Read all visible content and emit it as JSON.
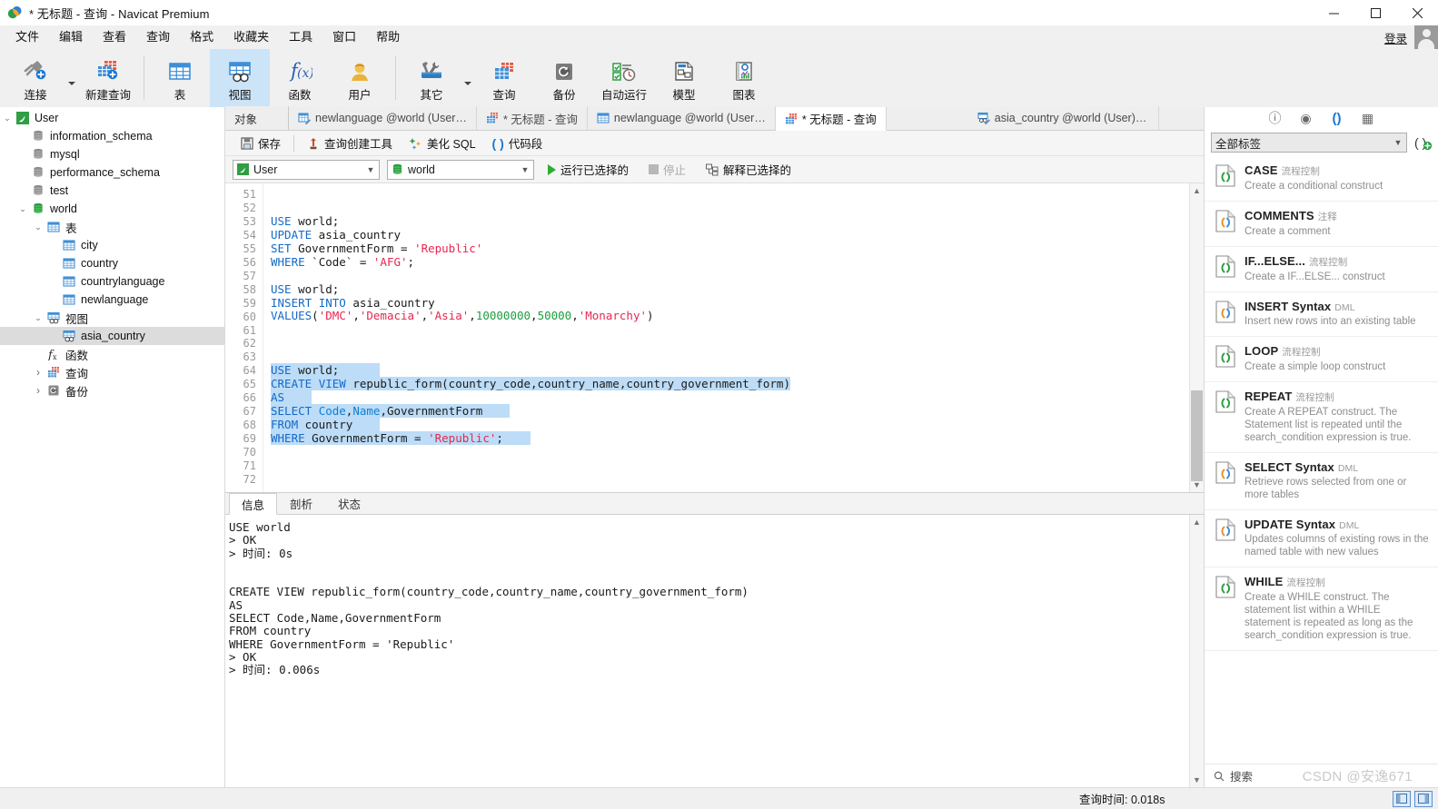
{
  "window": {
    "title": "* 无标题 - 查询 - Navicat Premium",
    "minimize": "—",
    "maximize": "▢",
    "close": "✕"
  },
  "menubar": {
    "items": [
      "文件",
      "编辑",
      "查看",
      "查询",
      "格式",
      "收藏夹",
      "工具",
      "窗口",
      "帮助"
    ],
    "login_label": "登录"
  },
  "toolbar": {
    "items": [
      {
        "label": "连接",
        "icon": "connection-icon",
        "has_caret": true
      },
      {
        "label": "新建查询",
        "icon": "new-query-icon",
        "has_caret": false
      },
      {
        "label": "表",
        "icon": "table-icon",
        "has_caret": false
      },
      {
        "label": "视图",
        "icon": "view-icon",
        "has_caret": false,
        "active": true
      },
      {
        "label": "函数",
        "icon": "function-icon",
        "has_caret": false
      },
      {
        "label": "用户",
        "icon": "user-icon",
        "has_caret": false
      },
      {
        "label": "其它",
        "icon": "other-tools-icon",
        "has_caret": true
      },
      {
        "label": "查询",
        "icon": "query-icon",
        "has_caret": false
      },
      {
        "label": "备份",
        "icon": "backup-icon",
        "has_caret": false
      },
      {
        "label": "自动运行",
        "icon": "automation-icon",
        "has_caret": false
      },
      {
        "label": "模型",
        "icon": "model-icon",
        "has_caret": false
      },
      {
        "label": "图表",
        "icon": "chart-icon",
        "has_caret": false
      }
    ]
  },
  "sidebar": {
    "nodes": [
      {
        "label": "User",
        "depth": 0,
        "twist": "open",
        "icon": "connection-mysql-icon"
      },
      {
        "label": "information_schema",
        "depth": 1,
        "twist": "none",
        "icon": "database-gray-icon"
      },
      {
        "label": "mysql",
        "depth": 1,
        "twist": "none",
        "icon": "database-gray-icon"
      },
      {
        "label": "performance_schema",
        "depth": 1,
        "twist": "none",
        "icon": "database-gray-icon"
      },
      {
        "label": "test",
        "depth": 1,
        "twist": "none",
        "icon": "database-gray-icon"
      },
      {
        "label": "world",
        "depth": 1,
        "twist": "open",
        "icon": "database-green-icon"
      },
      {
        "label": "表",
        "depth": 2,
        "twist": "open",
        "icon": "table-folder-icon"
      },
      {
        "label": "city",
        "depth": 3,
        "twist": "none",
        "icon": "table-icon"
      },
      {
        "label": "country",
        "depth": 3,
        "twist": "none",
        "icon": "table-icon"
      },
      {
        "label": "countrylanguage",
        "depth": 3,
        "twist": "none",
        "icon": "table-icon"
      },
      {
        "label": "newlanguage",
        "depth": 3,
        "twist": "none",
        "icon": "table-icon"
      },
      {
        "label": "视图",
        "depth": 2,
        "twist": "open",
        "icon": "view-folder-icon"
      },
      {
        "label": "asia_country",
        "depth": 3,
        "twist": "none",
        "icon": "view-icon",
        "selected": true
      },
      {
        "label": "函数",
        "depth": 2,
        "twist": "none",
        "icon": "function-icon"
      },
      {
        "label": "查询",
        "depth": 2,
        "twist": "closed",
        "icon": "query-icon"
      },
      {
        "label": "备份",
        "depth": 2,
        "twist": "closed",
        "icon": "backup-icon"
      }
    ]
  },
  "tabs": [
    {
      "label": "对象",
      "icon": "none",
      "type": "objects"
    },
    {
      "label": "newlanguage @world (User…",
      "icon": "table-designer-icon"
    },
    {
      "label": "* 无标题 - 查询",
      "icon": "query-icon"
    },
    {
      "label": "newlanguage @world (User…",
      "icon": "table-icon"
    },
    {
      "label": "* 无标题 - 查询",
      "icon": "query-icon",
      "active": true
    },
    {
      "label": "asia_country @world (User) …",
      "icon": "view-designer-icon"
    }
  ],
  "query_toolbar": {
    "save": "保存",
    "query_builder": "查询创建工具",
    "beautify_sql": "美化 SQL",
    "code_snippet": "代码段"
  },
  "selectors": {
    "connection_value": "User",
    "database_value": "world",
    "run_selected": "运行已选择的",
    "stop": "停止",
    "explain_selected": "解释已选择的"
  },
  "editor": {
    "first_line": 51,
    "lines": [
      {
        "n": 51,
        "tokens": []
      },
      {
        "n": 52,
        "tokens": []
      },
      {
        "n": 53,
        "tokens": [
          {
            "t": "USE",
            "c": "kw"
          },
          {
            "t": " world;",
            "c": ""
          }
        ]
      },
      {
        "n": 54,
        "tokens": [
          {
            "t": "UPDATE",
            "c": "kw"
          },
          {
            "t": " asia_country",
            "c": ""
          }
        ]
      },
      {
        "n": 55,
        "tokens": [
          {
            "t": "SET",
            "c": "kw"
          },
          {
            "t": " GovernmentForm = ",
            "c": ""
          },
          {
            "t": "'Republic'",
            "c": "str"
          }
        ]
      },
      {
        "n": 56,
        "tokens": [
          {
            "t": "WHERE",
            "c": "kw"
          },
          {
            "t": " `Code` = ",
            "c": ""
          },
          {
            "t": "'AFG'",
            "c": "str"
          },
          {
            "t": ";",
            "c": ""
          }
        ]
      },
      {
        "n": 57,
        "tokens": []
      },
      {
        "n": 58,
        "tokens": [
          {
            "t": "USE",
            "c": "kw"
          },
          {
            "t": " world;",
            "c": ""
          }
        ]
      },
      {
        "n": 59,
        "tokens": [
          {
            "t": "INSERT",
            "c": "kw"
          },
          {
            "t": " ",
            "c": ""
          },
          {
            "t": "INTO",
            "c": "kw"
          },
          {
            "t": " asia_country",
            "c": ""
          }
        ]
      },
      {
        "n": 60,
        "tokens": [
          {
            "t": "VALUES",
            "c": "kw"
          },
          {
            "t": "(",
            "c": ""
          },
          {
            "t": "'DMC'",
            "c": "str"
          },
          {
            "t": ",",
            "c": ""
          },
          {
            "t": "'Demacia'",
            "c": "str"
          },
          {
            "t": ",",
            "c": ""
          },
          {
            "t": "'Asia'",
            "c": "str"
          },
          {
            "t": ",",
            "c": ""
          },
          {
            "t": "10000000",
            "c": "num"
          },
          {
            "t": ",",
            "c": ""
          },
          {
            "t": "50000",
            "c": "num"
          },
          {
            "t": ",",
            "c": ""
          },
          {
            "t": "'Monarchy'",
            "c": "str"
          },
          {
            "t": ")",
            "c": ""
          }
        ]
      },
      {
        "n": 61,
        "tokens": []
      },
      {
        "n": 62,
        "tokens": []
      },
      {
        "n": 63,
        "tokens": []
      },
      {
        "n": 64,
        "selected": true,
        "sel_pad": 6,
        "tokens": [
          {
            "t": "USE",
            "c": "kw"
          },
          {
            "t": " world;",
            "c": ""
          }
        ]
      },
      {
        "n": 65,
        "selected": true,
        "sel_pad": 0,
        "tokens": [
          {
            "t": "CREATE",
            "c": "kw"
          },
          {
            "t": " ",
            "c": ""
          },
          {
            "t": "VIEW",
            "c": "kw"
          },
          {
            "t": " republic_form(country_code,country_name,country_government_form)",
            "c": ""
          }
        ]
      },
      {
        "n": 66,
        "selected": true,
        "sel_pad": 4,
        "tokens": [
          {
            "t": "AS",
            "c": "kw"
          }
        ]
      },
      {
        "n": 67,
        "selected": true,
        "sel_pad": 4,
        "tokens": [
          {
            "t": "SELECT",
            "c": "kw"
          },
          {
            "t": " ",
            "c": ""
          },
          {
            "t": "Code",
            "c": "kw2"
          },
          {
            "t": ",",
            "c": ""
          },
          {
            "t": "Name",
            "c": "kw2"
          },
          {
            "t": ",GovernmentForm",
            "c": ""
          }
        ]
      },
      {
        "n": 68,
        "selected": true,
        "sel_pad": 4,
        "tokens": [
          {
            "t": "FROM",
            "c": "kw"
          },
          {
            "t": " country",
            "c": ""
          }
        ]
      },
      {
        "n": 69,
        "selected": true,
        "sel_pad": 4,
        "tokens": [
          {
            "t": "WHERE",
            "c": "kw"
          },
          {
            "t": " GovernmentForm = ",
            "c": ""
          },
          {
            "t": "'Republic'",
            "c": "str"
          },
          {
            "t": ";",
            "c": ""
          }
        ]
      },
      {
        "n": 70,
        "tokens": []
      },
      {
        "n": 71,
        "tokens": []
      },
      {
        "n": 72,
        "tokens": []
      }
    ]
  },
  "results": {
    "tabs": [
      "信息",
      "剖析",
      "状态"
    ],
    "active_tab": "信息",
    "log": "USE world\n> OK\n> 时间: 0s\n\n\nCREATE VIEW republic_form(country_code,country_name,country_government_form)\nAS\nSELECT Code,Name,GovernmentForm\nFROM country\nWHERE GovernmentForm = 'Republic'\n> OK\n> 时间: 0.006s"
  },
  "right_panel": {
    "icons": [
      {
        "name": "info-icon",
        "glyph": "ⓘ",
        "active": false
      },
      {
        "name": "preview-eye-icon",
        "glyph": "◉",
        "active": false
      },
      {
        "name": "code-snippet-icon",
        "glyph": "()",
        "active": true
      },
      {
        "name": "grid-icon",
        "glyph": "▦",
        "active": false
      }
    ],
    "filter_value": "全部标签",
    "add_snippet_icon": "add-snippet-icon",
    "search_placeholder": "搜索",
    "snippets": [
      {
        "title": "CASE",
        "category": "流程控制",
        "desc": "Create a conditional construct",
        "color": "green"
      },
      {
        "title": "COMMENTS",
        "category": "注释",
        "desc": "Create a comment",
        "color": "orange"
      },
      {
        "title": "IF...ELSE...",
        "category": "流程控制",
        "desc": "Create a IF...ELSE... construct",
        "color": "green"
      },
      {
        "title": "INSERT Syntax",
        "category": "DML",
        "desc": "Insert new rows into an existing table",
        "color": "orange"
      },
      {
        "title": "LOOP",
        "category": "流程控制",
        "desc": "Create a simple loop construct",
        "color": "green"
      },
      {
        "title": "REPEAT",
        "category": "流程控制",
        "desc": "Create A REPEAT construct. The Statement list is repeated until the search_condition expression is true.",
        "color": "green"
      },
      {
        "title": "SELECT Syntax",
        "category": "DML",
        "desc": "Retrieve rows selected from one or more tables",
        "color": "orange"
      },
      {
        "title": "UPDATE Syntax",
        "category": "DML",
        "desc": "Updates columns of existing rows in the named table with new values",
        "color": "orange"
      },
      {
        "title": "WHILE",
        "category": "流程控制",
        "desc": "Create a WHILE construct. The statement list within a WHILE statement is repeated as long as the search_condition expression is true.",
        "color": "green"
      }
    ]
  },
  "statusbar": {
    "query_time": "查询时间: 0.018s",
    "watermark": "CSDN @安逸671"
  },
  "colors": {
    "accent": "#1877d2",
    "selection": "#bcdcf7",
    "keyword": "#1569c7",
    "string": "#e8264f",
    "number": "#1a9e3e",
    "toolbar_active": "#cce4f7"
  }
}
